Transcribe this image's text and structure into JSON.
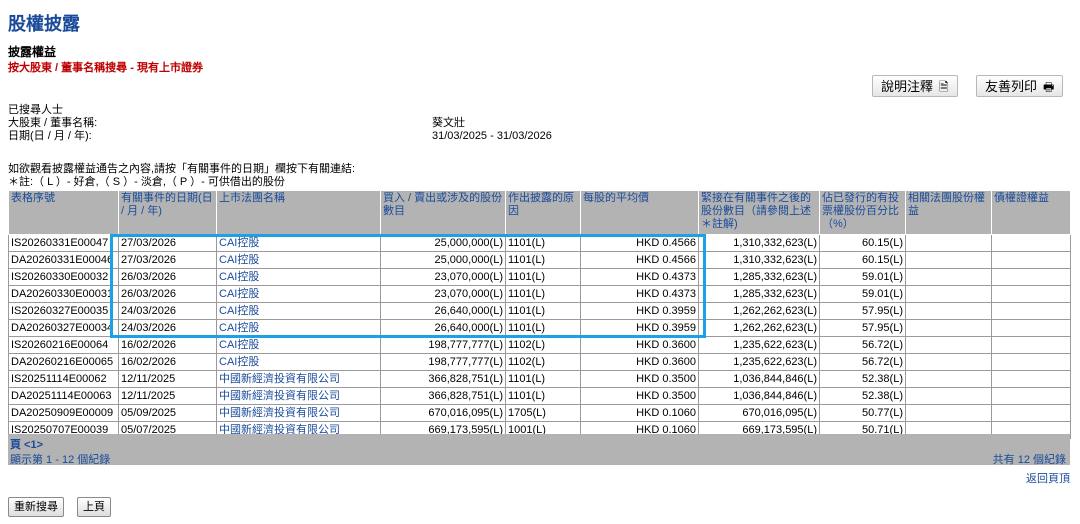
{
  "header": {
    "page_title": "股權披露",
    "section_title": "披露權益",
    "subtitle": "按大股東 / 董事名稱搜尋 - 現有上市證券"
  },
  "toolbar": {
    "notes_label": "說明注釋",
    "print_label": "友善列印"
  },
  "search_info": {
    "searched_label": "已搜尋人士",
    "name_label": "大股東 / 董事名稱:",
    "name_value": "葵文壯",
    "date_label": "日期(日 / 月 / 年):",
    "date_value": "31/03/2025 - 31/03/2026"
  },
  "instructions": {
    "line1": "如欲觀看披露權益通告之內容,請按「有關事件的日期」欄按下有關連結:",
    "line2": "＊註:（ L ）- 好倉,（ S ）- 淡倉,（ P ）- 可供借出的股份"
  },
  "table": {
    "headers": [
      "表格序號",
      "有關事件的日期(日 / 月 / 年)",
      "上市法團名稱",
      "買入 / 賣出或涉及的股份數目",
      "作出披露的原因",
      "每股的平均價",
      "緊接在有關事件之後的股份數目（請參閱上述＊註解)",
      "佔已發行的有投票權股份百分比（%）",
      "相關法團股份權益",
      "債權證權益"
    ],
    "rows": [
      {
        "form": "IS20260331E00047",
        "date": "27/03/2026",
        "company": "CAI控股",
        "shares": "25,000,000(L)",
        "reason": "1101(L)",
        "price": "HKD 0.4566",
        "after": "1,310,332,623(L)",
        "pct": "60.15(L)"
      },
      {
        "form": "DA20260331E00046",
        "date": "27/03/2026",
        "company": "CAI控股",
        "shares": "25,000,000(L)",
        "reason": "1101(L)",
        "price": "HKD 0.4566",
        "after": "1,310,332,623(L)",
        "pct": "60.15(L)"
      },
      {
        "form": "IS20260330E00032",
        "date": "26/03/2026",
        "company": "CAI控股",
        "shares": "23,070,000(L)",
        "reason": "1101(L)",
        "price": "HKD 0.4373",
        "after": "1,285,332,623(L)",
        "pct": "59.01(L)"
      },
      {
        "form": "DA20260330E00031",
        "date": "26/03/2026",
        "company": "CAI控股",
        "shares": "23,070,000(L)",
        "reason": "1101(L)",
        "price": "HKD 0.4373",
        "after": "1,285,332,623(L)",
        "pct": "59.01(L)"
      },
      {
        "form": "IS20260327E00035",
        "date": "24/03/2026",
        "company": "CAI控股",
        "shares": "26,640,000(L)",
        "reason": "1101(L)",
        "price": "HKD 0.3959",
        "after": "1,262,262,623(L)",
        "pct": "57.95(L)"
      },
      {
        "form": "DA20260327E00034",
        "date": "24/03/2026",
        "company": "CAI控股",
        "shares": "26,640,000(L)",
        "reason": "1101(L)",
        "price": "HKD 0.3959",
        "after": "1,262,262,623(L)",
        "pct": "57.95(L)"
      },
      {
        "form": "IS20260216E00064",
        "date": "16/02/2026",
        "company": "CAI控股",
        "shares": "198,777,777(L)",
        "reason": "1102(L)",
        "price": "HKD 0.3600",
        "after": "1,235,622,623(L)",
        "pct": "56.72(L)"
      },
      {
        "form": "DA20260216E00065",
        "date": "16/02/2026",
        "company": "CAI控股",
        "shares": "198,777,777(L)",
        "reason": "1102(L)",
        "price": "HKD 0.3600",
        "after": "1,235,622,623(L)",
        "pct": "56.72(L)"
      },
      {
        "form": "IS20251114E00062",
        "date": "12/11/2025",
        "company": "中國新經濟投資有限公司",
        "shares": "366,828,751(L)",
        "reason": "1101(L)",
        "price": "HKD 0.3500",
        "after": "1,036,844,846(L)",
        "pct": "52.38(L)"
      },
      {
        "form": "DA20251114E00063",
        "date": "12/11/2025",
        "company": "中國新經濟投資有限公司",
        "shares": "366,828,751(L)",
        "reason": "1101(L)",
        "price": "HKD 0.3500",
        "after": "1,036,844,846(L)",
        "pct": "52.38(L)"
      },
      {
        "form": "DA20250909E00009",
        "date": "05/09/2025",
        "company": "中國新經濟投資有限公司",
        "shares": "670,016,095(L)",
        "reason": "1705(L)",
        "price": "HKD 0.1060",
        "after": "670,016,095(L)",
        "pct": "50.77(L)"
      },
      {
        "form": "IS20250707E00039",
        "date": "05/07/2025",
        "company": "中國新經濟投資有限公司",
        "shares": "669,173,595(L)",
        "reason": "1001(L)",
        "price": "HKD 0.1060",
        "after": "669,173,595(L)",
        "pct": "50.71(L)"
      }
    ]
  },
  "footer": {
    "page_label": "頁 <1>",
    "shown_label": "顯示第 1 - 12 個紀錄",
    "total_label": "共有 12 個紀錄",
    "back_to_top": "返回頁頂"
  },
  "buttons": {
    "research": "重新搜尋",
    "previous": "上頁"
  },
  "colors": {
    "title_blue": "#1a4b9a",
    "subtitle_red": "#c00000",
    "header_gray": "#b3b3b3",
    "highlight_blue": "#1ea0e6"
  }
}
